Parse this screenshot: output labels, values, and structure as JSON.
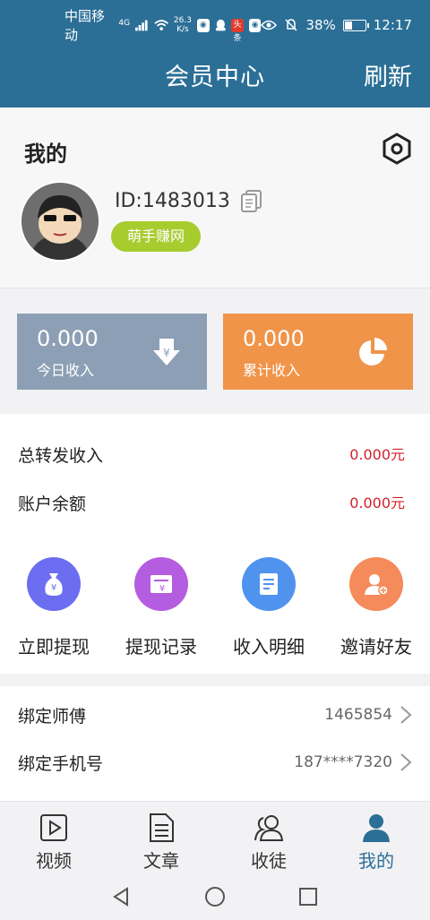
{
  "status_bar": {
    "carrier": "中国移动",
    "signal_tag": "4G",
    "net_speed_value": "26.3",
    "net_speed_unit": "K/s",
    "app_badge_text": "头条",
    "battery": "38%",
    "time": "12:17"
  },
  "header": {
    "title": "会员中心",
    "refresh_label": "刷新"
  },
  "profile": {
    "section_title": "我的",
    "id_text": "ID:1483013",
    "tag_label": "萌手赚网"
  },
  "cards": {
    "today": {
      "value": "0.000",
      "label": "今日收入",
      "color": "#8c9fb4"
    },
    "total": {
      "value": "0.000",
      "label": "累计收入",
      "color": "#f0944a"
    }
  },
  "income": {
    "forward_label": "总转发收入",
    "forward_value": "0.000元",
    "balance_label": "账户余额",
    "balance_value": "0.000元",
    "amount_color": "#d0232a"
  },
  "actions": [
    {
      "label": "立即提现",
      "icon": "money-bag-icon",
      "color": "#6b6ef0"
    },
    {
      "label": "提现记录",
      "icon": "receipt-icon",
      "color": "#b55de0"
    },
    {
      "label": "收入明细",
      "icon": "document-icon",
      "color": "#4f93ef"
    },
    {
      "label": "邀请好友",
      "icon": "add-user-icon",
      "color": "#f58a5a"
    }
  ],
  "binds": {
    "master_label": "绑定师傅",
    "master_value": "1465854",
    "phone_label": "绑定手机号",
    "phone_value": "187****7320"
  },
  "tabs": [
    {
      "label": "视频",
      "icon": "video-icon",
      "active": false
    },
    {
      "label": "文章",
      "icon": "article-icon",
      "active": false
    },
    {
      "label": "收徒",
      "icon": "users-icon",
      "active": false
    },
    {
      "label": "我的",
      "icon": "person-icon",
      "active": true
    }
  ],
  "colors": {
    "brand": "#2b6f96",
    "tag": "#a7cc2e"
  }
}
